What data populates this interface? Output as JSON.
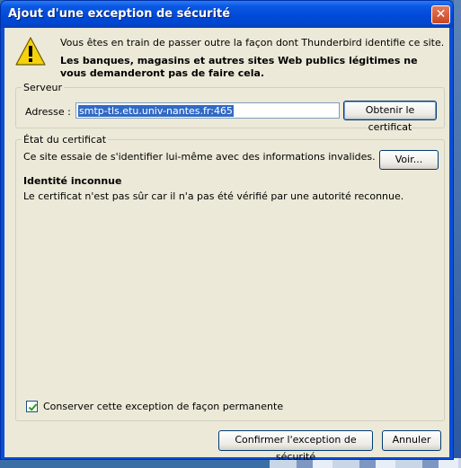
{
  "window": {
    "title": "Ajout d'une exception de sécurité",
    "close_glyph": "✕"
  },
  "warning": {
    "icon": "warning-triangle-icon",
    "line1": "Vous êtes en train de passer outre la façon dont Thunderbird identifie ce site.",
    "line2": "Les banques, magasins et autres sites Web publics légitimes ne vous demanderont pas de faire cela."
  },
  "server": {
    "legend": "Serveur",
    "address_label": "Adresse :",
    "address_value": "smtp-tls.etu.univ-nantes.fr:465",
    "get_cert_button": "Obtenir le certificat"
  },
  "certificate": {
    "legend": "État du certificat",
    "status_text": "Ce site essaie de s'identifier lui-même avec des informations invalides.",
    "view_button": "Voir...",
    "identity_title": "Identité inconnue",
    "identity_desc": "Le certificat n'est pas sûr car il n'a pas été vérifié par une autorité reconnue."
  },
  "permanent": {
    "checked": true,
    "label": "Conserver cette exception de façon permanente"
  },
  "buttons": {
    "confirm": "Confirmer l'exception de sécurité",
    "cancel": "Annuler"
  },
  "colors": {
    "titlebar": "#0a58e4",
    "dialog_bg": "#ece9d8",
    "selection": "#316ac5"
  }
}
